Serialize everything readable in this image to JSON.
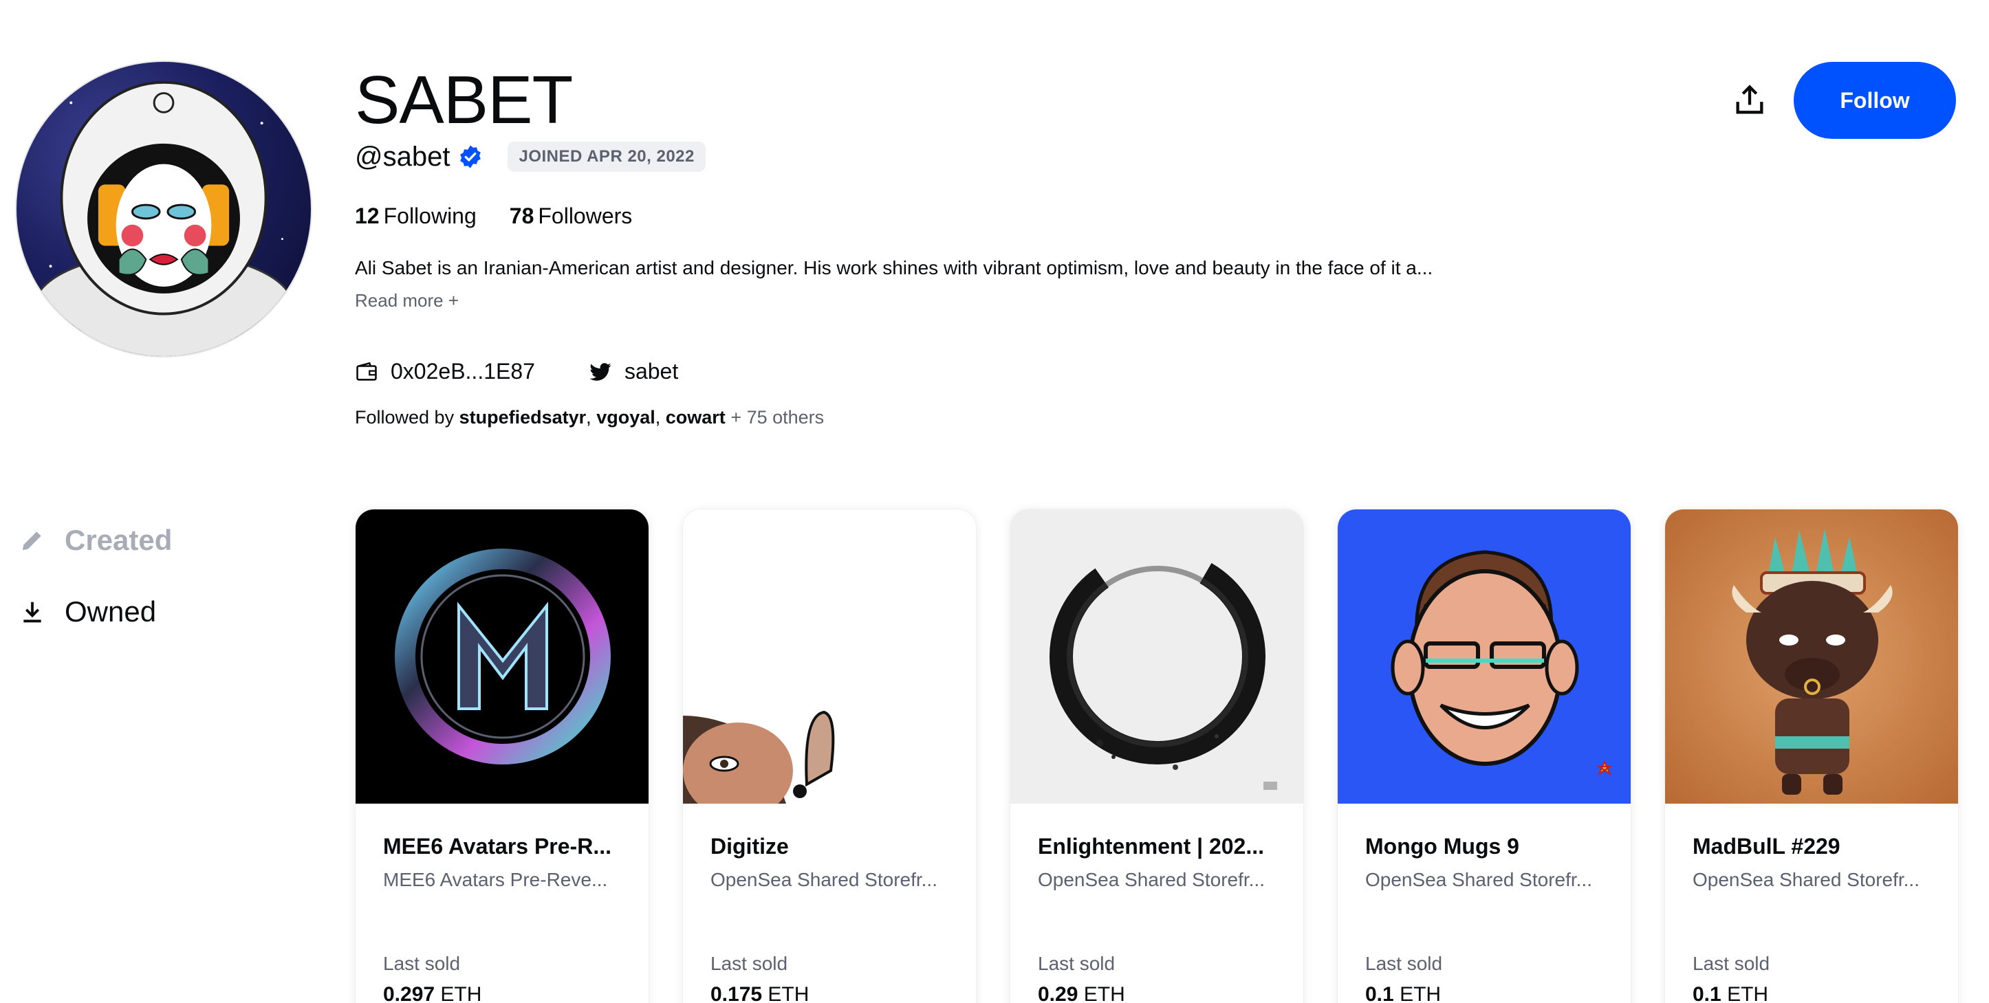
{
  "profile": {
    "name": "SABET",
    "handle": "@sabet",
    "joined": "JOINED APR 20, 2022",
    "following_count": "12",
    "following_label": "Following",
    "followers_count": "78",
    "followers_label": "Followers",
    "bio": "Ali Sabet is an Iranian-American artist and designer. His work shines with vibrant optimism, love and beauty in the face of it a...",
    "read_more": "Read more +",
    "wallet": "0x02eB...1E87",
    "twitter": "sabet",
    "followed_by_prefix": "Followed by",
    "followed_by_1": "stupefiedsatyr",
    "followed_by_2": "vgoyal",
    "followed_by_3": "cowart",
    "followed_by_others": "+ 75 others",
    "separator": ","
  },
  "actions": {
    "follow_label": "Follow"
  },
  "tabs": {
    "created": "Created",
    "owned": "Owned"
  },
  "cards": [
    {
      "title": "MEE6 Avatars Pre-R...",
      "collection": "MEE6 Avatars Pre-Reve...",
      "last_label": "Last sold",
      "price": "0.297",
      "currency": "ETH"
    },
    {
      "title": "Digitize",
      "collection": "OpenSea Shared Storefr...",
      "last_label": "Last sold",
      "price": "0.175",
      "currency": "ETH"
    },
    {
      "title": "Enlightenment | 202...",
      "collection": "OpenSea Shared Storefr...",
      "last_label": "Last sold",
      "price": "0.29",
      "currency": "ETH"
    },
    {
      "title": "Mongo Mugs 9",
      "collection": "OpenSea Shared Storefr...",
      "last_label": "Last sold",
      "price": "0.1",
      "currency": "ETH"
    },
    {
      "title": "MadBulL #229",
      "collection": "OpenSea Shared Storefr...",
      "last_label": "Last sold",
      "price": "0.1",
      "currency": "ETH"
    }
  ],
  "colors": {
    "accent": "#0052ff",
    "muted": "#5b616e"
  }
}
